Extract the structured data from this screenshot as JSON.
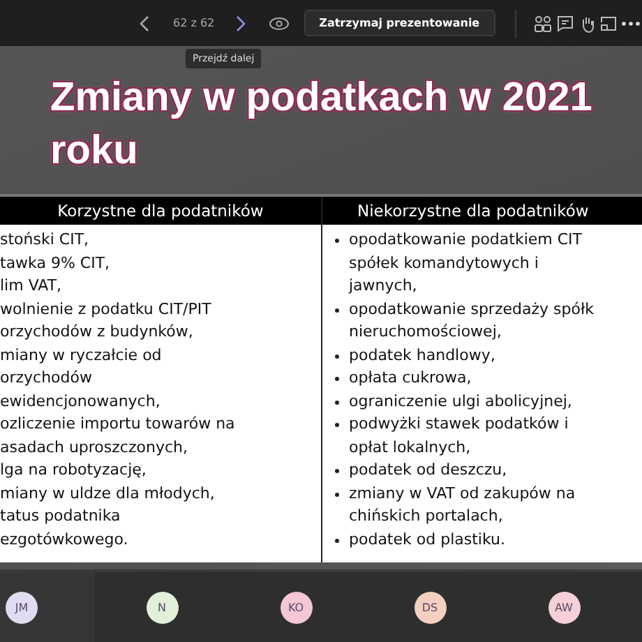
{
  "toolbar": {
    "page_counter": "62 z 62",
    "stop_button": "Zatrzymaj prezentowanie",
    "tooltip": "Przejdź dalej"
  },
  "slide": {
    "title": "Zmiany w podatkach w 2021 roku",
    "columns": [
      {
        "heading": "Korzystne dla podatników",
        "kind": "plain",
        "items": [
          {
            "lines": [
              "stoński CIT,"
            ]
          },
          {
            "lines": [
              "tawka 9% CIT,"
            ]
          },
          {
            "lines": [
              "lim VAT,"
            ]
          },
          {
            "lines": [
              "wolnienie z podatku CIT/PIT",
              "orzychodów z budynków,"
            ]
          },
          {
            "lines": [
              "miany w ryczałcie od",
              "orzychodów",
              "ewidencjonowanych,"
            ]
          },
          {
            "lines": [
              "ozliczenie importu towarów na",
              "asadach uproszczonych,"
            ]
          },
          {
            "lines": [
              "lga na robotyzację,"
            ]
          },
          {
            "lines": [
              "miany w uldze dla młodych,"
            ]
          },
          {
            "lines": [
              "tatus podatnika",
              "ezgotówkowego."
            ]
          }
        ]
      },
      {
        "heading": "Niekorzystne dla podatników",
        "kind": "bulleted",
        "items": [
          {
            "lines": [
              "opodatkowanie podatkiem CIT",
              "spółek komandytowych i",
              "jawnych,"
            ]
          },
          {
            "lines": [
              "opodatkowanie sprzedaży spółk",
              "nieruchomościowej,"
            ]
          },
          {
            "lines": [
              "podatek handlowy,"
            ]
          },
          {
            "lines": [
              "opłata cukrowa,"
            ]
          },
          {
            "lines": [
              "ograniczenie ulgi abolicyjnej,"
            ]
          },
          {
            "lines": [
              "podwyżki stawek podatków i",
              "opłat lokalnych,"
            ]
          },
          {
            "lines": [
              "podatek od deszczu,"
            ]
          },
          {
            "lines": [
              "zmiany w VAT od zakupów na",
              "chińskich portalach,"
            ]
          },
          {
            "lines": [
              "podatek od plastiku."
            ]
          }
        ]
      }
    ]
  },
  "participants": [
    {
      "initials": "JM",
      "color": "#e0ddf2"
    },
    {
      "initials": "N",
      "color": "#e2efd9"
    },
    {
      "initials": "KO",
      "color": "#f4c6d6"
    },
    {
      "initials": "DS",
      "color": "#f5cfc0"
    },
    {
      "initials": "AW",
      "color": "#f6d0d6"
    }
  ]
}
